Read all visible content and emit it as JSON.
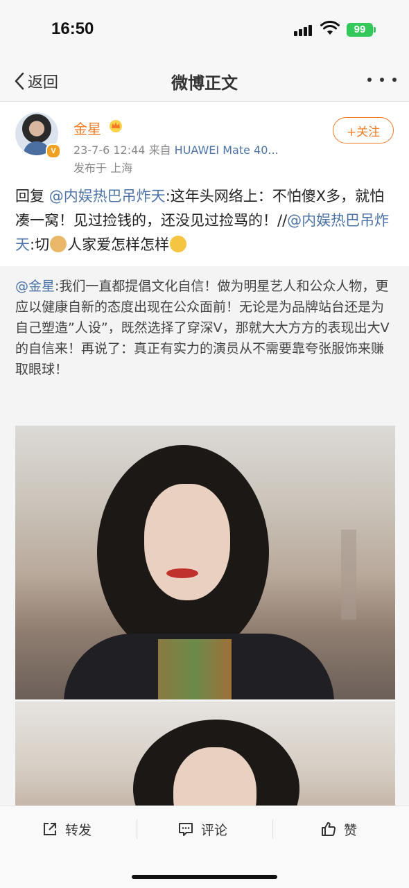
{
  "status_bar": {
    "time": "16:50",
    "battery": "99"
  },
  "nav": {
    "back_label": "返回",
    "title": "微博正文"
  },
  "author": {
    "name": "金星",
    "date": "23-7-6 12:44",
    "source_prefix": "来自",
    "source": "HUAWEI Mate 40...",
    "location": "发布于 上海",
    "follow_label": "+关注"
  },
  "post": {
    "reply_prefix": "回复",
    "mention1": "@内娱热巴吊炸天",
    "text1": ":这年头网络上：不怕傻X多，就怕凑一窝！见过捡钱的，还没见过捡骂的！//",
    "mention2": "@内娱热巴吊炸天",
    "text2": ":切",
    "text3": "人家爱怎样怎样"
  },
  "repost": {
    "mention": "@金星",
    "text": ":我们一直都提倡文化自信！做为明星艺人和公众人物，更应以健康自新的态度出现在公众面前！无论是为品牌站台还是为自己塑造”人设”，既然选择了穿深V，那就大大方方的表现出大V的自信来！再说了：真正有实力的演员从不需要靠夸张服饰来赚取眼球！"
  },
  "actions": {
    "repost": "转发",
    "comment": "评论",
    "like": "赞"
  },
  "colors": {
    "accent": "#f47a23",
    "link": "#4d74a8",
    "battery": "#34c759"
  }
}
